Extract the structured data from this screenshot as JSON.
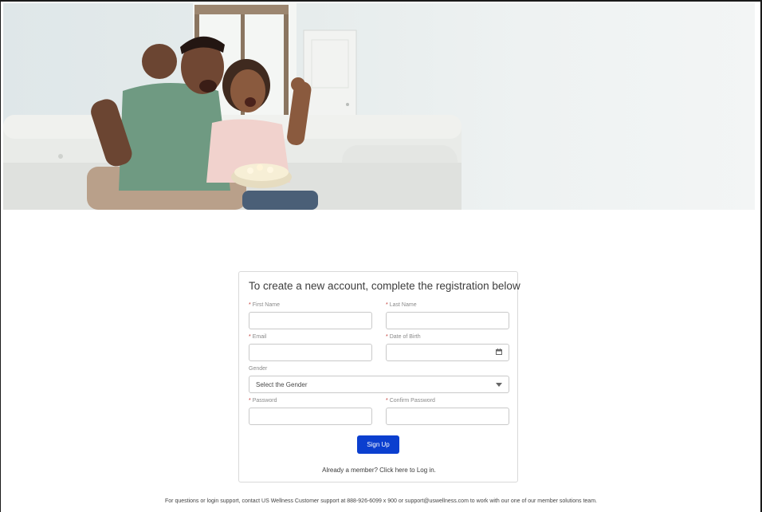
{
  "form": {
    "title": "To create a new account, complete the registration below",
    "required_mark": "*",
    "first_name_label": "First Name",
    "last_name_label": "Last Name",
    "email_label": "Email",
    "dob_label": "Date of Birth",
    "gender_label": "Gender",
    "gender_value": "Select the Gender",
    "password_label": "Password",
    "confirm_password_label": "Confirm Password",
    "signup_label": "Sign Up",
    "login_prompt": "Already a member? Click here to Log in."
  },
  "footer": {
    "text": "For questions or login support, contact US Wellness Customer support at 888-926-6099 x 900 or support@uswellness.com to work with our one of our member solutions team."
  },
  "hero": {
    "image": "father-and-child-cheering-on-couch"
  },
  "colors": {
    "primary_button": "#0b3fcf",
    "required": "#c23934"
  }
}
